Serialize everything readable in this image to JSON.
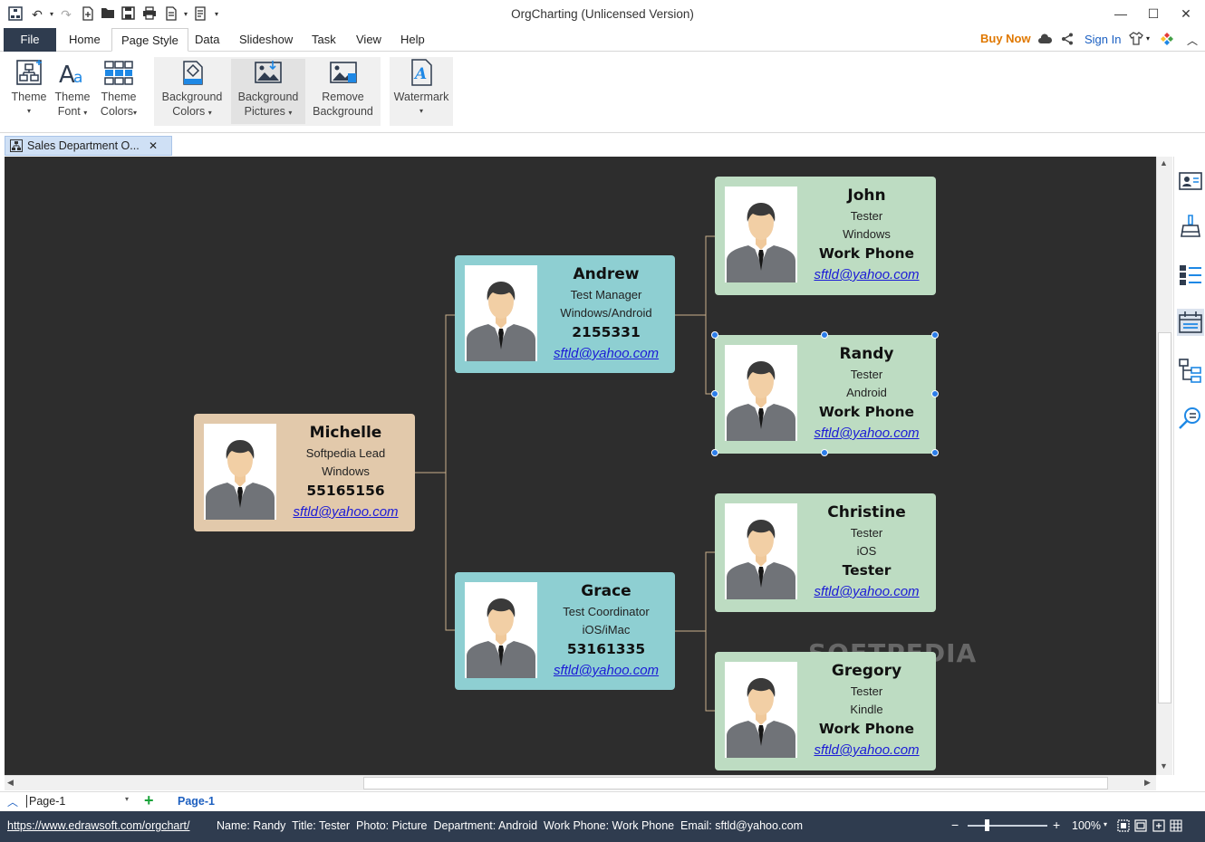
{
  "window": {
    "title": "OrgCharting (Unlicensed Version)",
    "controls": [
      "minimize",
      "maximize",
      "close"
    ]
  },
  "menu": {
    "file": "File",
    "items": [
      "Home",
      "Page Style",
      "Data",
      "Slideshow",
      "Task",
      "View",
      "Help"
    ],
    "active": "Page Style",
    "buy_now": "Buy Now",
    "sign_in": "Sign In"
  },
  "ribbon": {
    "theme": {
      "line1": "Theme",
      "line2": ""
    },
    "theme_font": {
      "line1": "Theme",
      "line2": "Font"
    },
    "theme_colors": {
      "line1": "Theme",
      "line2": "Colors"
    },
    "background_colors": {
      "line1": "Background",
      "line2": "Colors"
    },
    "background_pictures": {
      "line1": "Background",
      "line2": "Pictures"
    },
    "remove_background": {
      "line1": "Remove",
      "line2": "Background"
    },
    "watermark": {
      "line1": "Watermark",
      "line2": ""
    }
  },
  "document_tab": {
    "label": "Sales Department O..."
  },
  "org": {
    "michelle": {
      "name": "Michelle",
      "title": "Softpedia Lead",
      "department": "Windows",
      "phone": "55165156",
      "email": "sftld@yahoo.com"
    },
    "andrew": {
      "name": "Andrew",
      "title": "Test Manager",
      "department": "Windows/Android",
      "phone": "2155331",
      "email": "sftld@yahoo.com"
    },
    "grace": {
      "name": "Grace",
      "title": "Test Coordinator",
      "department": "iOS/iMac",
      "phone": "53161335",
      "email": "sftld@yahoo.com"
    },
    "john": {
      "name": "John",
      "title": "Tester",
      "department": "Windows",
      "phone": "Work Phone",
      "email": "sftld@yahoo.com"
    },
    "randy": {
      "name": "Randy",
      "title": "Tester",
      "department": "Android",
      "phone": "Work Phone",
      "email": "sftld@yahoo.com"
    },
    "christine": {
      "name": "Christine",
      "title": "Tester",
      "department": "iOS",
      "phone": "Tester",
      "email": "sftld@yahoo.com"
    },
    "gregory": {
      "name": "Gregory",
      "title": "Tester",
      "department": "Kindle",
      "phone": "Work Phone",
      "email": "sftld@yahoo.com"
    }
  },
  "watermark_text": "SOFTPEDIA",
  "pages": {
    "dropdown": "Page-1",
    "active_tab": "Page-1"
  },
  "status": {
    "url": "https://www.edrawsoft.com/orgchart/",
    "details": "Name: Randy  Title: Tester  Photo: Picture  Department: Android  Work Phone: Work Phone  Email: sftld@yahoo.com",
    "zoom": "100%"
  },
  "colors": {
    "canvas": "#2d2d2d",
    "root_card": "#e2c9ab",
    "manager_card": "#8ecfd2",
    "member_card": "#bddcc2",
    "connector": "#c9b08a",
    "selection": "#2b7de9",
    "statusbar": "#2f3c4f"
  }
}
